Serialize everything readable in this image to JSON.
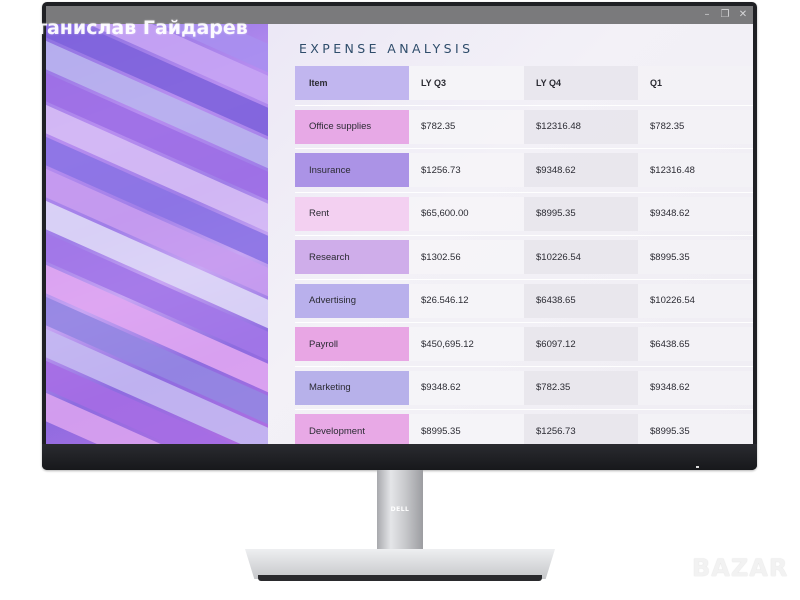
{
  "watermarks": {
    "owner_name": "Станислав Гайдарев",
    "site_logo": "BAZAR"
  },
  "window": {
    "controls": [
      {
        "name": "minimize",
        "icon": "minimize-icon",
        "glyph": "–"
      },
      {
        "name": "restore",
        "icon": "restore-icon",
        "glyph": "❐"
      },
      {
        "name": "close",
        "icon": "close-icon",
        "glyph": "✕"
      }
    ]
  },
  "panel": {
    "title": "EXPENSE ANALYSIS"
  },
  "table": {
    "headers": [
      "Item",
      "LY Q3",
      "LY Q4",
      "Q1"
    ],
    "rows": [
      {
        "item": "Office supplies",
        "ly_q3": "$782.35",
        "ly_q4": "$12316.48",
        "q1": "$782.35",
        "color": "#e7a9e6"
      },
      {
        "item": "Insurance",
        "ly_q3": "$1256.73",
        "ly_q4": "$9348.62",
        "q1": "$12316.48",
        "color": "#ab93e6"
      },
      {
        "item": "Rent",
        "ly_q3": "$65,600.00",
        "ly_q4": "$8995.35",
        "q1": "$9348.62",
        "color": "#f3d0f1"
      },
      {
        "item": "Research",
        "ly_q3": "$1302.56",
        "ly_q4": "$10226.54",
        "q1": "$8995.35",
        "color": "#cfadea"
      },
      {
        "item": "Advertising",
        "ly_q3": "$26.546.12",
        "ly_q4": "$6438.65",
        "q1": "$10226.54",
        "color": "#b9b0ec"
      },
      {
        "item": "Payroll",
        "ly_q3": "$450,695.12",
        "ly_q4": "$6097.12",
        "q1": "$6438.65",
        "color": "#e8a6e4"
      },
      {
        "item": "Marketing",
        "ly_q3": "$9348.62",
        "ly_q4": "$782.35",
        "q1": "$9348.62",
        "color": "#b7b1ea"
      },
      {
        "item": "Development",
        "ly_q3": "$8995.35",
        "ly_q4": "$1256.73",
        "q1": "$8995.35",
        "color": "#e8a9e6"
      }
    ],
    "header_item_color": "#c1b6ef"
  },
  "hardware": {
    "brand_logo": "DELL"
  }
}
